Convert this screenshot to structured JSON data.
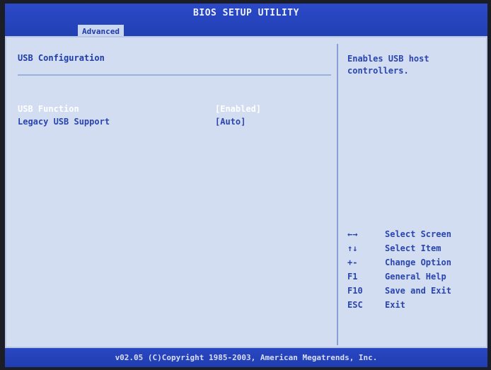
{
  "title": "BIOS SETUP UTILITY",
  "active_tab": "Advanced",
  "section_title": "USB Configuration",
  "options": [
    {
      "label": "USB Function",
      "value": "[Enabled]",
      "selected": true
    },
    {
      "label": "Legacy USB Support",
      "value": "[Auto]",
      "selected": false
    }
  ],
  "help_text": "Enables USB host controllers.",
  "key_help": [
    {
      "key": "←→",
      "desc": "Select Screen"
    },
    {
      "key": "↑↓",
      "desc": "Select Item"
    },
    {
      "key": "+-",
      "desc": "Change Option"
    },
    {
      "key": "F1",
      "desc": "General Help"
    },
    {
      "key": "F10",
      "desc": "Save and Exit"
    },
    {
      "key": "ESC",
      "desc": "Exit"
    }
  ],
  "footer": "v02.05 (C)Copyright 1985-2003, American Megatrends, Inc.",
  "colors": {
    "header_blue": "#2c49c8",
    "panel_bg": "#d2ddf2",
    "text_blue": "#2a45ad",
    "selected_text": "#ffffff"
  }
}
